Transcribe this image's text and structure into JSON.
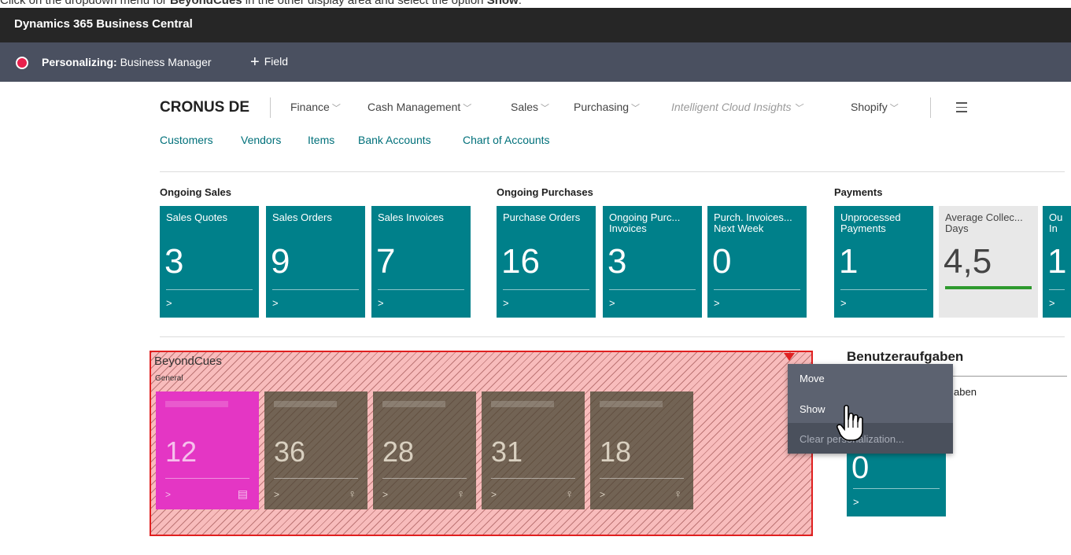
{
  "caption": {
    "before": "Click on the dropdown menu for ",
    "bold1": "BeyondCues",
    "middle": " in the other display area and select the option ",
    "bold2": "Show",
    "after": "."
  },
  "app": {
    "title": "Dynamics 365 Business Central"
  },
  "personalize": {
    "label": "Personalizing:",
    "profile": "Business Manager",
    "field_button": "Field"
  },
  "company": "CRONUS DE",
  "menus": [
    {
      "label": "Finance",
      "italic": false
    },
    {
      "label": "Cash Management",
      "italic": false
    },
    {
      "label": "Sales",
      "italic": false
    },
    {
      "label": "Purchasing",
      "italic": false
    },
    {
      "label": "Intelligent Cloud Insights",
      "italic": true
    },
    {
      "label": "Shopify",
      "italic": false
    }
  ],
  "links": [
    "Customers",
    "Vendors",
    "Items",
    "Bank Accounts",
    "Chart of Accounts"
  ],
  "groups": {
    "sales": {
      "title": "Ongoing Sales",
      "tiles": [
        {
          "label": "Sales Quotes",
          "value": "3"
        },
        {
          "label": "Sales Orders",
          "value": "9"
        },
        {
          "label": "Sales Invoices",
          "value": "7"
        }
      ]
    },
    "purchases": {
      "title": "Ongoing Purchases",
      "tiles": [
        {
          "label": "Purchase Orders",
          "value": "16"
        },
        {
          "label": "Ongoing Purc... Invoices",
          "value": "3"
        },
        {
          "label": "Purch. Invoices... Next Week",
          "value": "0"
        }
      ]
    },
    "payments": {
      "title": "Payments",
      "tiles": [
        {
          "label": "Unprocessed Payments",
          "value": "1"
        },
        {
          "label": "Average Collec... Days",
          "value": "4,5"
        },
        {
          "label": "Ou In",
          "value": "1"
        }
      ]
    }
  },
  "beyond": {
    "title": "BeyondCues",
    "subtitle": "General",
    "tiles": [
      "12",
      "36",
      "28",
      "31",
      "18"
    ]
  },
  "context_menu": {
    "move": "Move",
    "show": "Show",
    "clear": "Clear personalization..."
  },
  "tasks": {
    "title": "Benutzeraufgaben",
    "partial_label": "aben",
    "tile_value": "0"
  },
  "glyphs": {
    "chevron": "⌵",
    "arrow": ">",
    "person": "♀"
  }
}
